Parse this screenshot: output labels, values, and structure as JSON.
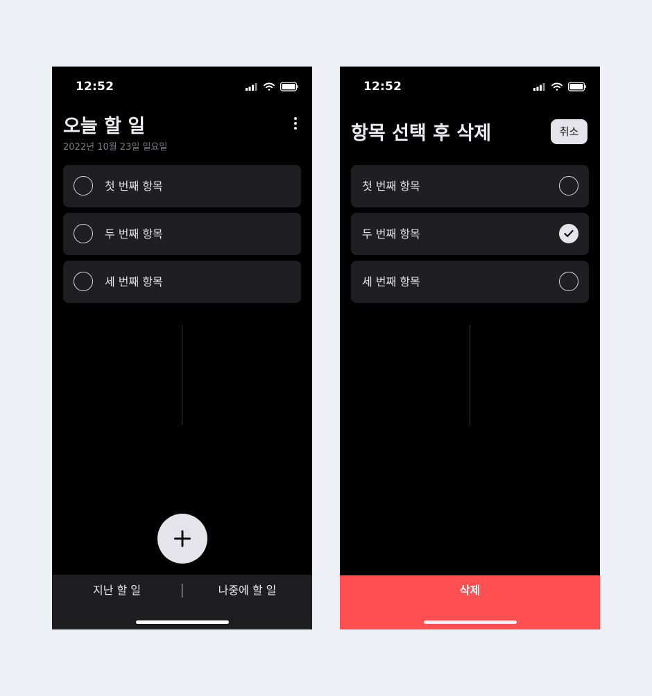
{
  "colors": {
    "background": "#edf1f5",
    "phone_background": "#000000",
    "item_background": "#1f1f21",
    "accent_light": "#e4e4ea",
    "delete_red": "#ff4f50"
  },
  "left_screen": {
    "status_time": "12:52",
    "title": "오늘 할 일",
    "date": "2022년 10월 23일 일요일",
    "menu_icon": "more-vertical-icon",
    "items": [
      {
        "label": "첫 번째 항목",
        "checked": false
      },
      {
        "label": "두 번째 항목",
        "checked": false
      },
      {
        "label": "세 번째 항목",
        "checked": false
      }
    ],
    "fab_icon": "plus-icon",
    "bottom_tabs": [
      {
        "label": "지난 할 일"
      },
      {
        "label": "나중에 할 일"
      }
    ]
  },
  "right_screen": {
    "status_time": "12:52",
    "title": "항목 선택 후 삭제",
    "cancel_label": "취소",
    "items": [
      {
        "label": "첫 번째 항목",
        "checked": false
      },
      {
        "label": "두 번째 항목",
        "checked": true
      },
      {
        "label": "세 번째 항목",
        "checked": false
      }
    ],
    "delete_label": "삭제"
  }
}
